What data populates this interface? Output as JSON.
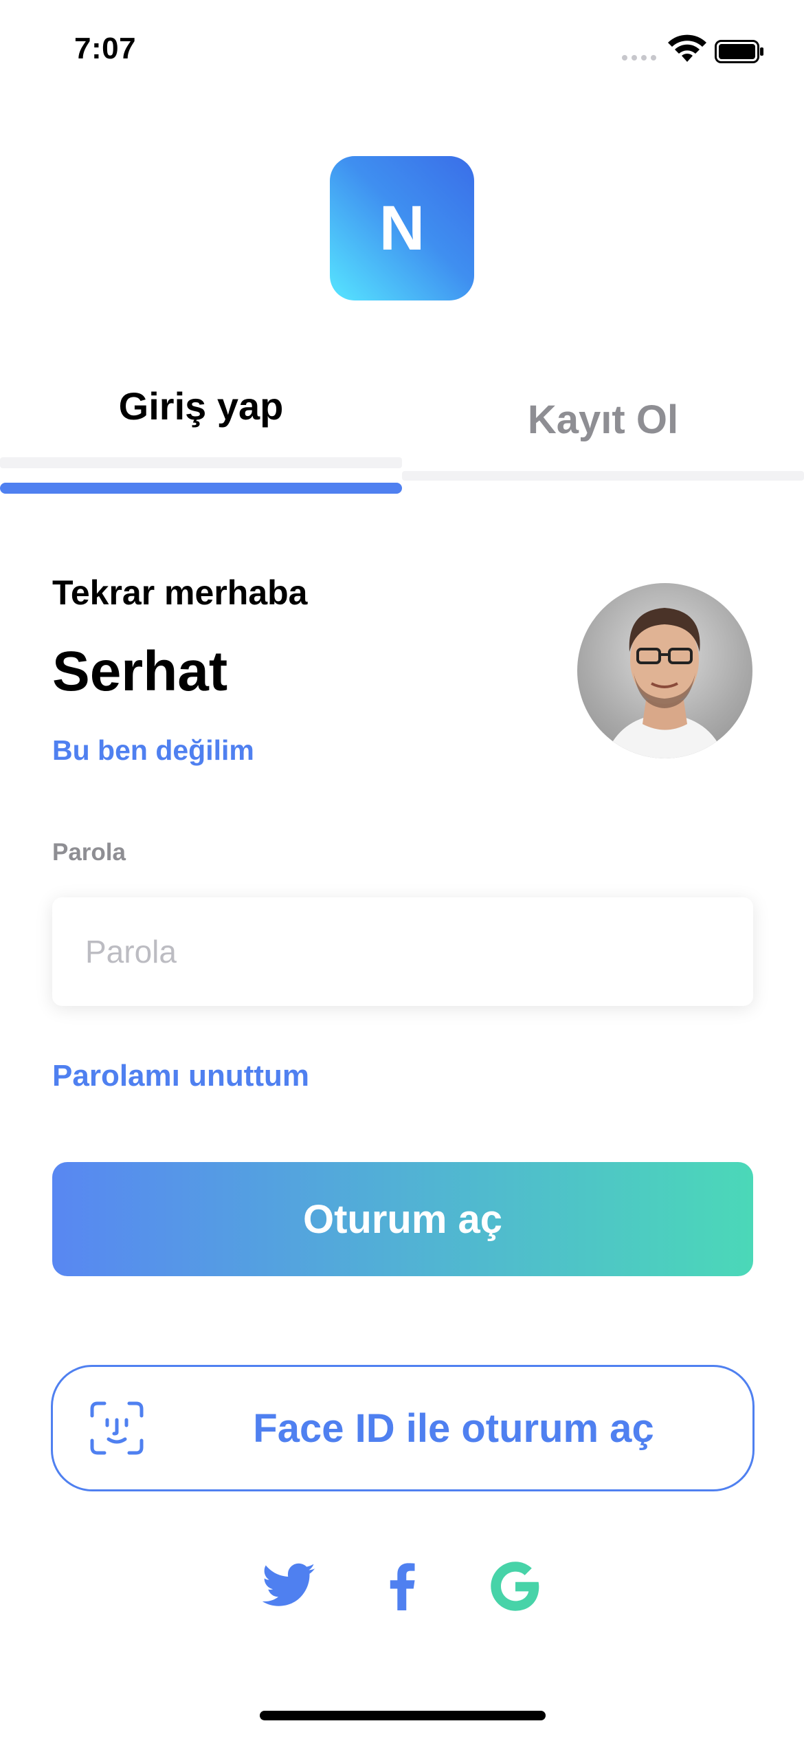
{
  "status_bar": {
    "time": "7:07"
  },
  "logo": {
    "letter": "N"
  },
  "tabs": {
    "login": "Giriş yap",
    "register": "Kayıt Ol"
  },
  "welcome": {
    "greeting": "Tekrar merhaba",
    "name": "Serhat",
    "not_me": "Bu ben değilim"
  },
  "password": {
    "label": "Parola",
    "placeholder": "Parola",
    "value": "",
    "forgot": "Parolamı unuttum"
  },
  "buttons": {
    "login": "Oturum aç",
    "faceid": "Face ID ile oturum aç"
  },
  "social": [
    "twitter-icon",
    "facebook-icon",
    "google-icon"
  ],
  "colors": {
    "accent": "#4f80f0",
    "gradient_start": "#5887f2",
    "gradient_end": "#4bd8b8",
    "google": "#47d3a8"
  }
}
